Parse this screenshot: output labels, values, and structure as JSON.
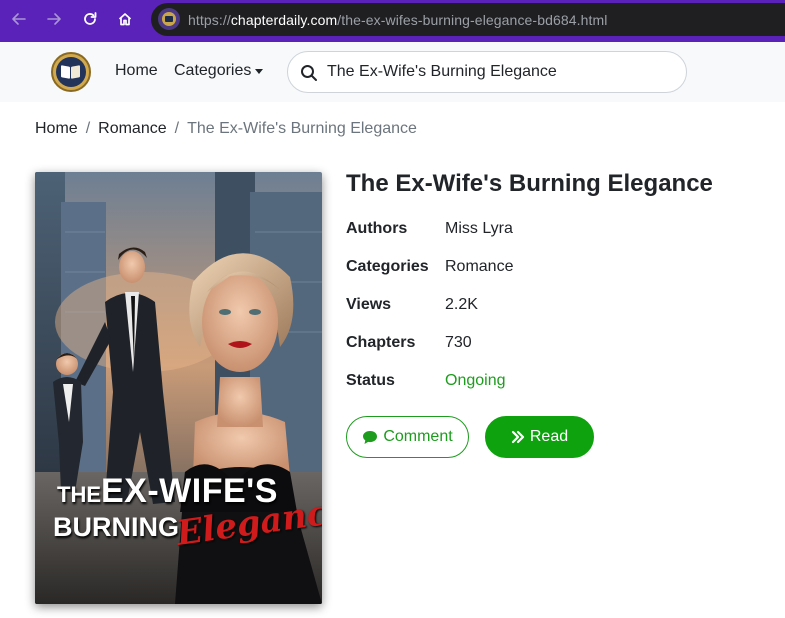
{
  "browser": {
    "url_prefix": "https://",
    "url_host": "chapterdaily.com",
    "url_path": "/the-ex-wifes-burning-elegance-bd684.html",
    "accent": "#5a22b8"
  },
  "header": {
    "nav": {
      "home": "Home",
      "categories": "Categories"
    },
    "search": {
      "value": "The Ex-Wife's Burning Elegance"
    }
  },
  "breadcrumb": {
    "items": [
      "Home",
      "Romance"
    ],
    "separator": "/",
    "active": "The Ex-Wife's Burning Elegance"
  },
  "book": {
    "title": "The Ex-Wife's Burning Elegance",
    "cover_text": {
      "line1_the": "THE",
      "line1_rest": "EX-WIFE'S",
      "line2": "BURNING",
      "line3": "Elegance"
    },
    "meta": [
      {
        "label": "Authors",
        "value": "Miss Lyra"
      },
      {
        "label": "Categories",
        "value": "Romance"
      },
      {
        "label": "Views",
        "value": "2.2K"
      },
      {
        "label": "Chapters",
        "value": "730"
      },
      {
        "label": "Status",
        "value": "Ongoing"
      }
    ],
    "status_color": "#1e9c1e"
  },
  "actions": {
    "comment": "Comment",
    "read": "Read",
    "read_color": "#0ea30e"
  }
}
